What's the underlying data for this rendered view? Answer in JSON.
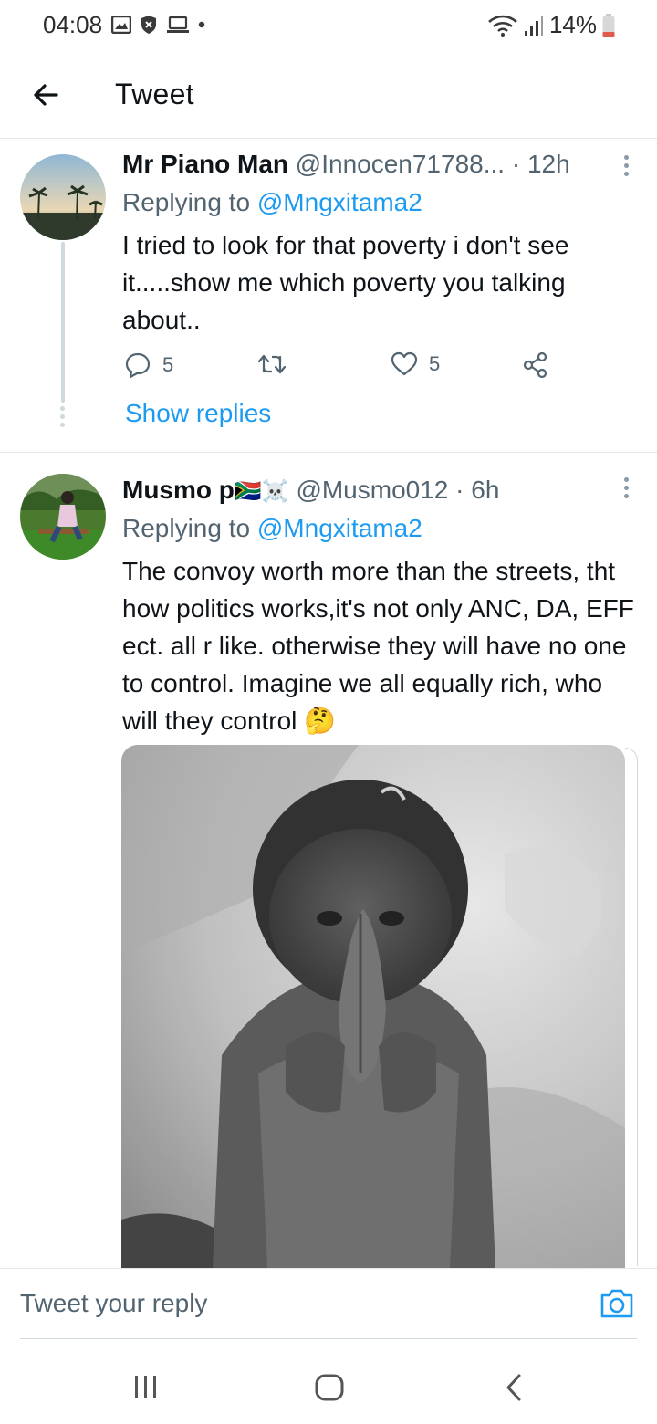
{
  "status_bar": {
    "time": "04:08",
    "battery": "14%"
  },
  "header": {
    "title": "Tweet"
  },
  "tweets": [
    {
      "name": "Mr Piano Man",
      "handle": "@Innocen71788...",
      "time": "12h",
      "reply_prefix": "Replying to ",
      "reply_to": "@Mngxitama2",
      "text": "I tried to look for that poverty i don't see it.....show me which poverty you talking about..",
      "reply_count": "5",
      "like_count": "5",
      "show_replies": "Show replies"
    },
    {
      "name": "Musmo p",
      "name_emoji": "🇿🇦☠️",
      "handle": "@Musmo012",
      "time": "6h",
      "reply_prefix": "Replying to ",
      "reply_to": "@Mngxitama2",
      "text": "The convoy worth more than the streets, tht how politics works,it's not only ANC, DA, EFF ect. all r like. otherwise they will have no one to control. Imagine we all equally rich, who will they control",
      "text_emoji": "🤔"
    }
  ],
  "reply_bar": {
    "placeholder": "Tweet your reply"
  },
  "colors": {
    "link": "#1d9bf0",
    "secondary_text": "#536471",
    "divider": "#e1e8ed"
  },
  "icons": {
    "back": "arrow-left-icon",
    "more": "more-vertical-icon",
    "reply": "comment-icon",
    "retweet": "retweet-icon",
    "like": "heart-icon",
    "share": "share-icon",
    "camera": "camera-icon"
  }
}
